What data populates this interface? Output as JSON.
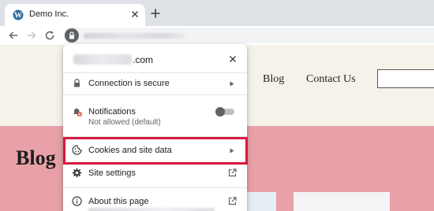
{
  "browser": {
    "tab": {
      "title": "Demo Inc.",
      "favicon": "wordpress-icon"
    },
    "toolbar": {
      "back": "back-arrow-icon",
      "forward": "forward-arrow-icon",
      "reload": "reload-icon"
    }
  },
  "site": {
    "nav": {
      "blog": "Blog",
      "contact": "Contact Us"
    },
    "hero_title": "Blog"
  },
  "popup": {
    "domain_suffix": ".com",
    "rows": {
      "connection": {
        "label": "Connection is secure",
        "icon": "lock-icon"
      },
      "notifications": {
        "label": "Notifications",
        "sub": "Not allowed (default)",
        "icon": "bell-blocked-icon",
        "toggle_on": false
      },
      "cookies": {
        "label": "Cookies and site data",
        "icon": "cookie-icon"
      },
      "settings": {
        "label": "Site settings",
        "icon": "gear-icon"
      },
      "about": {
        "label": "About this page",
        "icon": "info-icon"
      }
    }
  },
  "colors": {
    "highlight": "#d7193f",
    "hero_bg": "#e8a1a8",
    "header_bg": "#f5f2ea"
  }
}
